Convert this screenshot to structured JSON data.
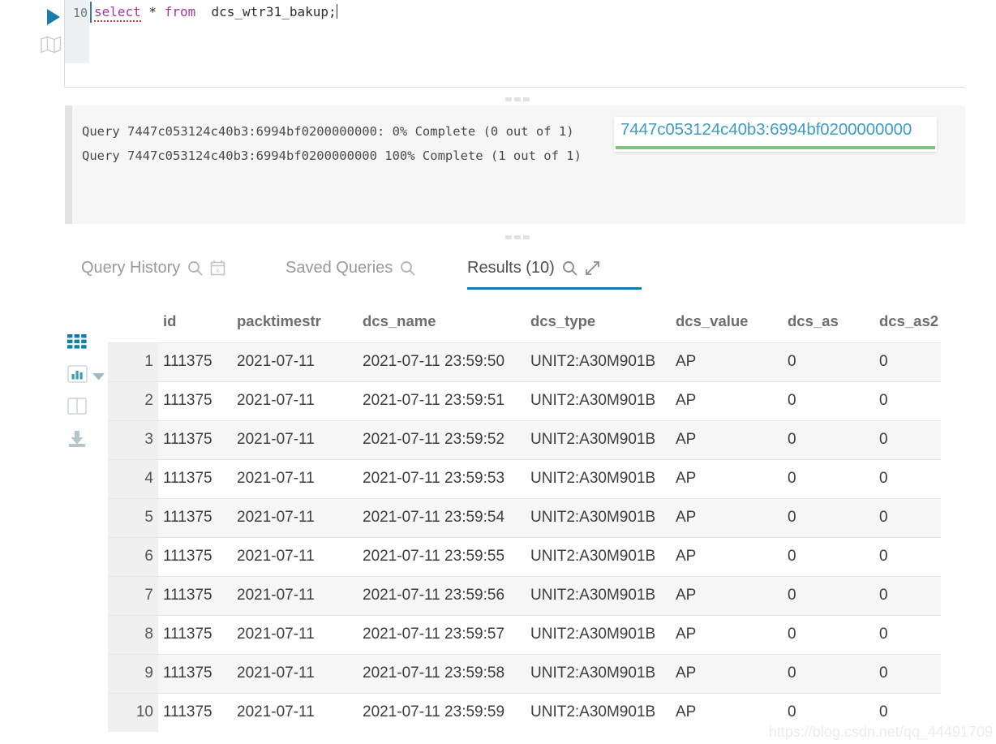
{
  "editor": {
    "line_number": "10",
    "code_tokens": [
      {
        "text": "select",
        "type": "keyword-error"
      },
      {
        "text": " * ",
        "type": "plain"
      },
      {
        "text": "from",
        "type": "keyword"
      },
      {
        "text": "  dcs_wtr31_bakup;",
        "type": "plain"
      }
    ],
    "code_plain": "select * from  dcs_wtr31_bakup;",
    "run_icon": "play-icon",
    "explain_icon": "map-icon",
    "explain_caret_icon": "chevron-down-icon"
  },
  "output_log": {
    "lines": [
      "Query 7447c053124c40b3:6994bf0200000000: 0% Complete (0 out of 1)",
      "Query 7447c053124c40b3:6994bf0200000000 100% Complete (1 out of 1)"
    ]
  },
  "query_link_popup": {
    "query_id": "7447c053124c40b3:6994bf0200000000",
    "link_color": "#3f9cc8",
    "progress_color": "#7cc47f",
    "progress_percent": 100
  },
  "tabs": [
    {
      "id": "query-history",
      "label": "Query History",
      "active": false,
      "icons": [
        "search-icon",
        "calendar-clear-icon"
      ]
    },
    {
      "id": "saved-queries",
      "label": "Saved Queries",
      "active": false,
      "icons": [
        "search-icon"
      ]
    },
    {
      "id": "results",
      "label": "Results (10)",
      "active": true,
      "icons": [
        "search-icon",
        "expand-icon"
      ]
    }
  ],
  "active_tab_color": "#0d7eb0",
  "result_tools": [
    {
      "id": "grid-view",
      "icon": "grid-icon",
      "active": true
    },
    {
      "id": "chart-view",
      "icon": "bar-chart-icon",
      "active": false,
      "caret": "chevron-down-icon"
    },
    {
      "id": "split-view",
      "icon": "columns-icon",
      "active": false
    },
    {
      "id": "export",
      "icon": "download-icon",
      "active": false
    }
  ],
  "table": {
    "columns": [
      "",
      "id",
      "packtimestr",
      "dcs_name",
      "dcs_type",
      "dcs_value",
      "dcs_as",
      "dcs_as2"
    ],
    "rows": [
      {
        "idx": "1",
        "id": "111375",
        "packtimestr": "2021-07-11",
        "dcs_name": "2021-07-11 23:59:50",
        "dcs_type": "UNIT2:A30M901B",
        "dcs_value": "AP",
        "dcs_as": "0",
        "dcs_as2": "0"
      },
      {
        "idx": "2",
        "id": "111375",
        "packtimestr": "2021-07-11",
        "dcs_name": "2021-07-11 23:59:51",
        "dcs_type": "UNIT2:A30M901B",
        "dcs_value": "AP",
        "dcs_as": "0",
        "dcs_as2": "0"
      },
      {
        "idx": "3",
        "id": "111375",
        "packtimestr": "2021-07-11",
        "dcs_name": "2021-07-11 23:59:52",
        "dcs_type": "UNIT2:A30M901B",
        "dcs_value": "AP",
        "dcs_as": "0",
        "dcs_as2": "0"
      },
      {
        "idx": "4",
        "id": "111375",
        "packtimestr": "2021-07-11",
        "dcs_name": "2021-07-11 23:59:53",
        "dcs_type": "UNIT2:A30M901B",
        "dcs_value": "AP",
        "dcs_as": "0",
        "dcs_as2": "0"
      },
      {
        "idx": "5",
        "id": "111375",
        "packtimestr": "2021-07-11",
        "dcs_name": "2021-07-11 23:59:54",
        "dcs_type": "UNIT2:A30M901B",
        "dcs_value": "AP",
        "dcs_as": "0",
        "dcs_as2": "0"
      },
      {
        "idx": "6",
        "id": "111375",
        "packtimestr": "2021-07-11",
        "dcs_name": "2021-07-11 23:59:55",
        "dcs_type": "UNIT2:A30M901B",
        "dcs_value": "AP",
        "dcs_as": "0",
        "dcs_as2": "0"
      },
      {
        "idx": "7",
        "id": "111375",
        "packtimestr": "2021-07-11",
        "dcs_name": "2021-07-11 23:59:56",
        "dcs_type": "UNIT2:A30M901B",
        "dcs_value": "AP",
        "dcs_as": "0",
        "dcs_as2": "0"
      },
      {
        "idx": "8",
        "id": "111375",
        "packtimestr": "2021-07-11",
        "dcs_name": "2021-07-11 23:59:57",
        "dcs_type": "UNIT2:A30M901B",
        "dcs_value": "AP",
        "dcs_as": "0",
        "dcs_as2": "0"
      },
      {
        "idx": "9",
        "id": "111375",
        "packtimestr": "2021-07-11",
        "dcs_name": "2021-07-11 23:59:58",
        "dcs_type": "UNIT2:A30M901B",
        "dcs_value": "AP",
        "dcs_as": "0",
        "dcs_as2": "0"
      },
      {
        "idx": "10",
        "id": "111375",
        "packtimestr": "2021-07-11",
        "dcs_name": "2021-07-11 23:59:59",
        "dcs_type": "UNIT2:A30M901B",
        "dcs_value": "AP",
        "dcs_as": "0",
        "dcs_as2": "0"
      }
    ]
  },
  "watermark": "https://blog.csdn.net/qq_44491709"
}
